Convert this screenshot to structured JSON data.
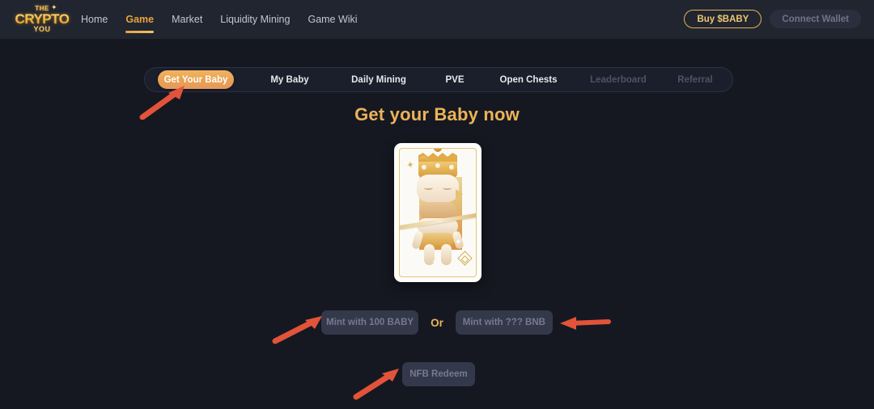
{
  "header": {
    "logo": {
      "line1": "THE",
      "line2": "CRYPTO",
      "line3": "YOU",
      "sparkle": "✦"
    },
    "nav": [
      {
        "label": "Home",
        "active": false
      },
      {
        "label": "Game",
        "active": true
      },
      {
        "label": "Market",
        "active": false
      },
      {
        "label": "Liquidity Mining",
        "active": false
      },
      {
        "label": "Game Wiki",
        "active": false
      }
    ],
    "buy_button": "Buy $BABY",
    "connect_button": "Connect Wallet",
    "accent_color": "#e3b255",
    "background_color": "#202530"
  },
  "tabs": [
    {
      "label": "Get Your Baby",
      "state": "active"
    },
    {
      "label": "My Baby",
      "state": "enabled"
    },
    {
      "label": "Daily Mining",
      "state": "enabled"
    },
    {
      "label": "PVE",
      "state": "enabled"
    },
    {
      "label": "Open Chests",
      "state": "enabled"
    },
    {
      "label": "Leaderboard",
      "state": "disabled"
    },
    {
      "label": "Referral",
      "state": "disabled"
    }
  ],
  "main": {
    "title": "Get your Baby now",
    "title_color": "#edb358",
    "card": {
      "alt": "baby-nft-card",
      "border_color": "#e3c675",
      "background_color": "#fdfdfb"
    },
    "mint_baby_button": "Mint with 100 BABY",
    "or_label": "Or",
    "mint_bnb_button": "Mint with ??? BNB",
    "redeem_button": "NFB Redeem",
    "button_color": "#33384a",
    "button_text_color": "#757b8e"
  },
  "annotations": {
    "color": "#e2533a",
    "arrows": [
      {
        "name": "arrow-to-get-your-baby-tab",
        "direction": "up-right"
      },
      {
        "name": "arrow-to-mint-baby-button",
        "direction": "up-right"
      },
      {
        "name": "arrow-to-mint-bnb-button",
        "direction": "left"
      },
      {
        "name": "arrow-to-nfb-redeem-button",
        "direction": "up-right"
      }
    ]
  },
  "page": {
    "background_color": "#151821"
  }
}
